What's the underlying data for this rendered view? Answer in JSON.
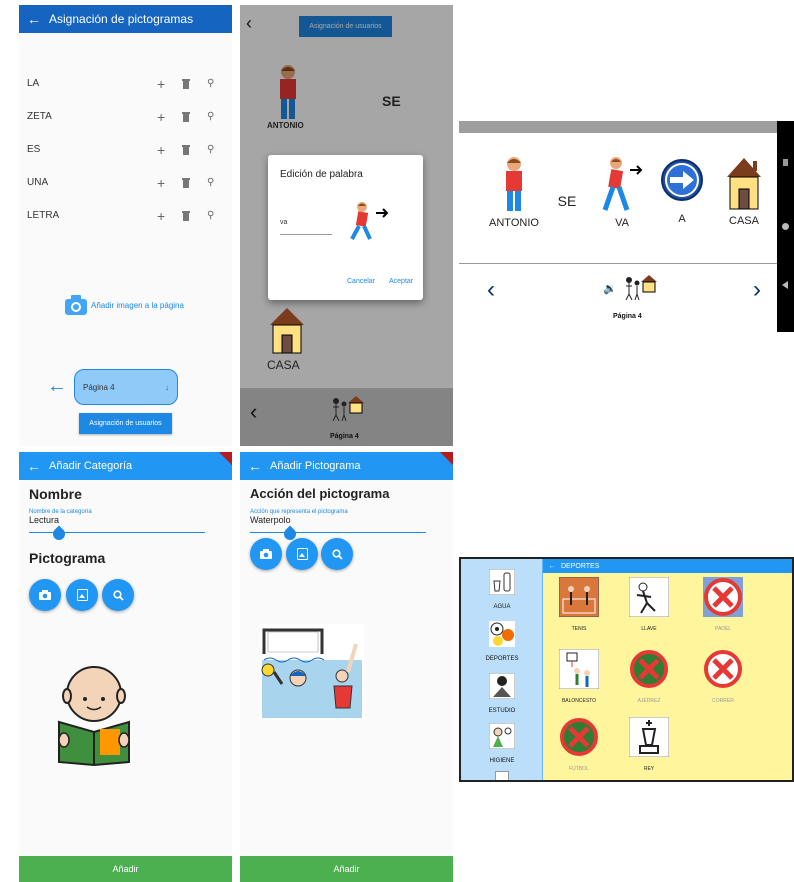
{
  "p1": {
    "title": "Asignación de pictogramas",
    "rows": [
      "LA",
      "ZETA",
      "ES",
      "UNA",
      "LETRA"
    ],
    "add_image": "Añadir imagen a la página",
    "page_select": "Página 4",
    "assign_button": "Asignación de usuarios"
  },
  "p2": {
    "assign_button": "Asignación de usuarios",
    "antonio": "ANTONIO",
    "se": "SE",
    "dialog_title": "Edición de palabra",
    "word_value": "va",
    "cancel": "Cancelar",
    "accept": "Aceptar",
    "casa": "CASA",
    "page": "Página 4"
  },
  "p3": {
    "words": [
      "ANTONIO",
      "SE",
      "VA",
      "A",
      "CASA"
    ],
    "page": "Página 4"
  },
  "p4": {
    "title": "Añadir Categoría",
    "name_heading": "Nombre",
    "field_label": "Nombre de la categoría",
    "field_value": "Lectura",
    "picto_heading": "Pictograma",
    "add": "Añadir"
  },
  "p5": {
    "title": "Añadir Pictograma",
    "heading": "Acción del pictograma",
    "field_label": "Acción que representa el pictograma",
    "field_value": "Waterpolo",
    "add": "Añadir"
  },
  "p6": {
    "title": "DEPORTES",
    "sidebar": [
      "AGUA",
      "DEPORTES",
      "ESTUDIO",
      "HIGIENE"
    ],
    "tiles": [
      "TENIS",
      "LLAVE",
      "PADEL",
      "BALONCESTO",
      "AJEDREZ",
      "CORRER",
      "FÚTBOL",
      "REY"
    ]
  },
  "colors": {
    "blue": "#2196f3",
    "dark_blue": "#0d47a1",
    "green": "#4caf50",
    "yellow": "#fff59d"
  }
}
